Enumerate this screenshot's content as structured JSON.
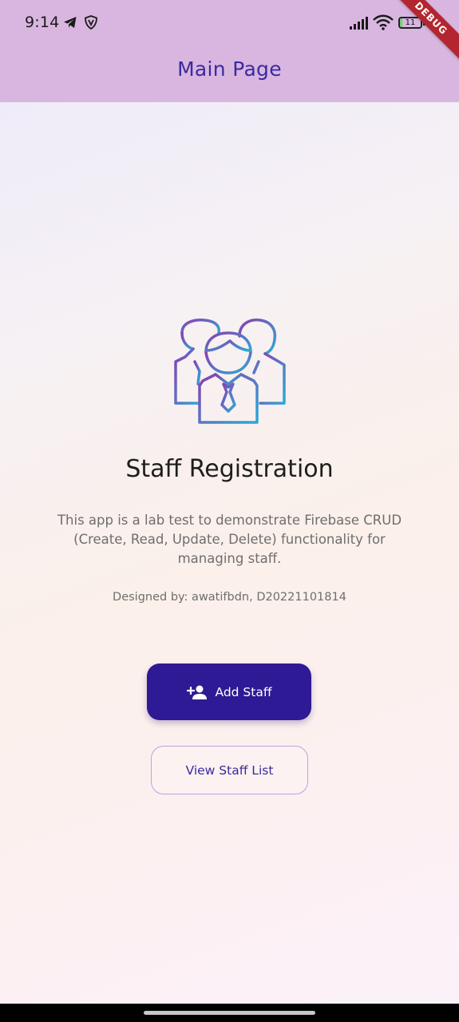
{
  "status_bar": {
    "time": "9:14",
    "battery_level": "11",
    "battery_fraction": 0.11,
    "icons": [
      "telegram-icon",
      "vpn-shield-icon",
      "signal-icon",
      "wifi-icon",
      "battery-icon"
    ]
  },
  "debug_banner": "DEBUG",
  "app_bar": {
    "title": "Main Page"
  },
  "main": {
    "icon": "staff-group-icon",
    "heading": "Staff Registration",
    "description": "This app is a lab test to demonstrate Firebase CRUD (Create, Read, Update, Delete) functionality for managing staff.",
    "credit": "Designed by: awatifbdn,  D20221101814"
  },
  "actions": {
    "add_label": "Add Staff",
    "add_icon": "person-add-icon",
    "view_label": "View Staff List"
  },
  "colors": {
    "app_bar": "#d9b6e0",
    "title": "#3a2b9e",
    "primary_button": "#2e1a95",
    "outline_button_border": "#b8a4de",
    "icon_gradient_start": "#8a3fb0",
    "icon_gradient_end": "#2ca9d6",
    "debug_ribbon": "#b3262f"
  }
}
